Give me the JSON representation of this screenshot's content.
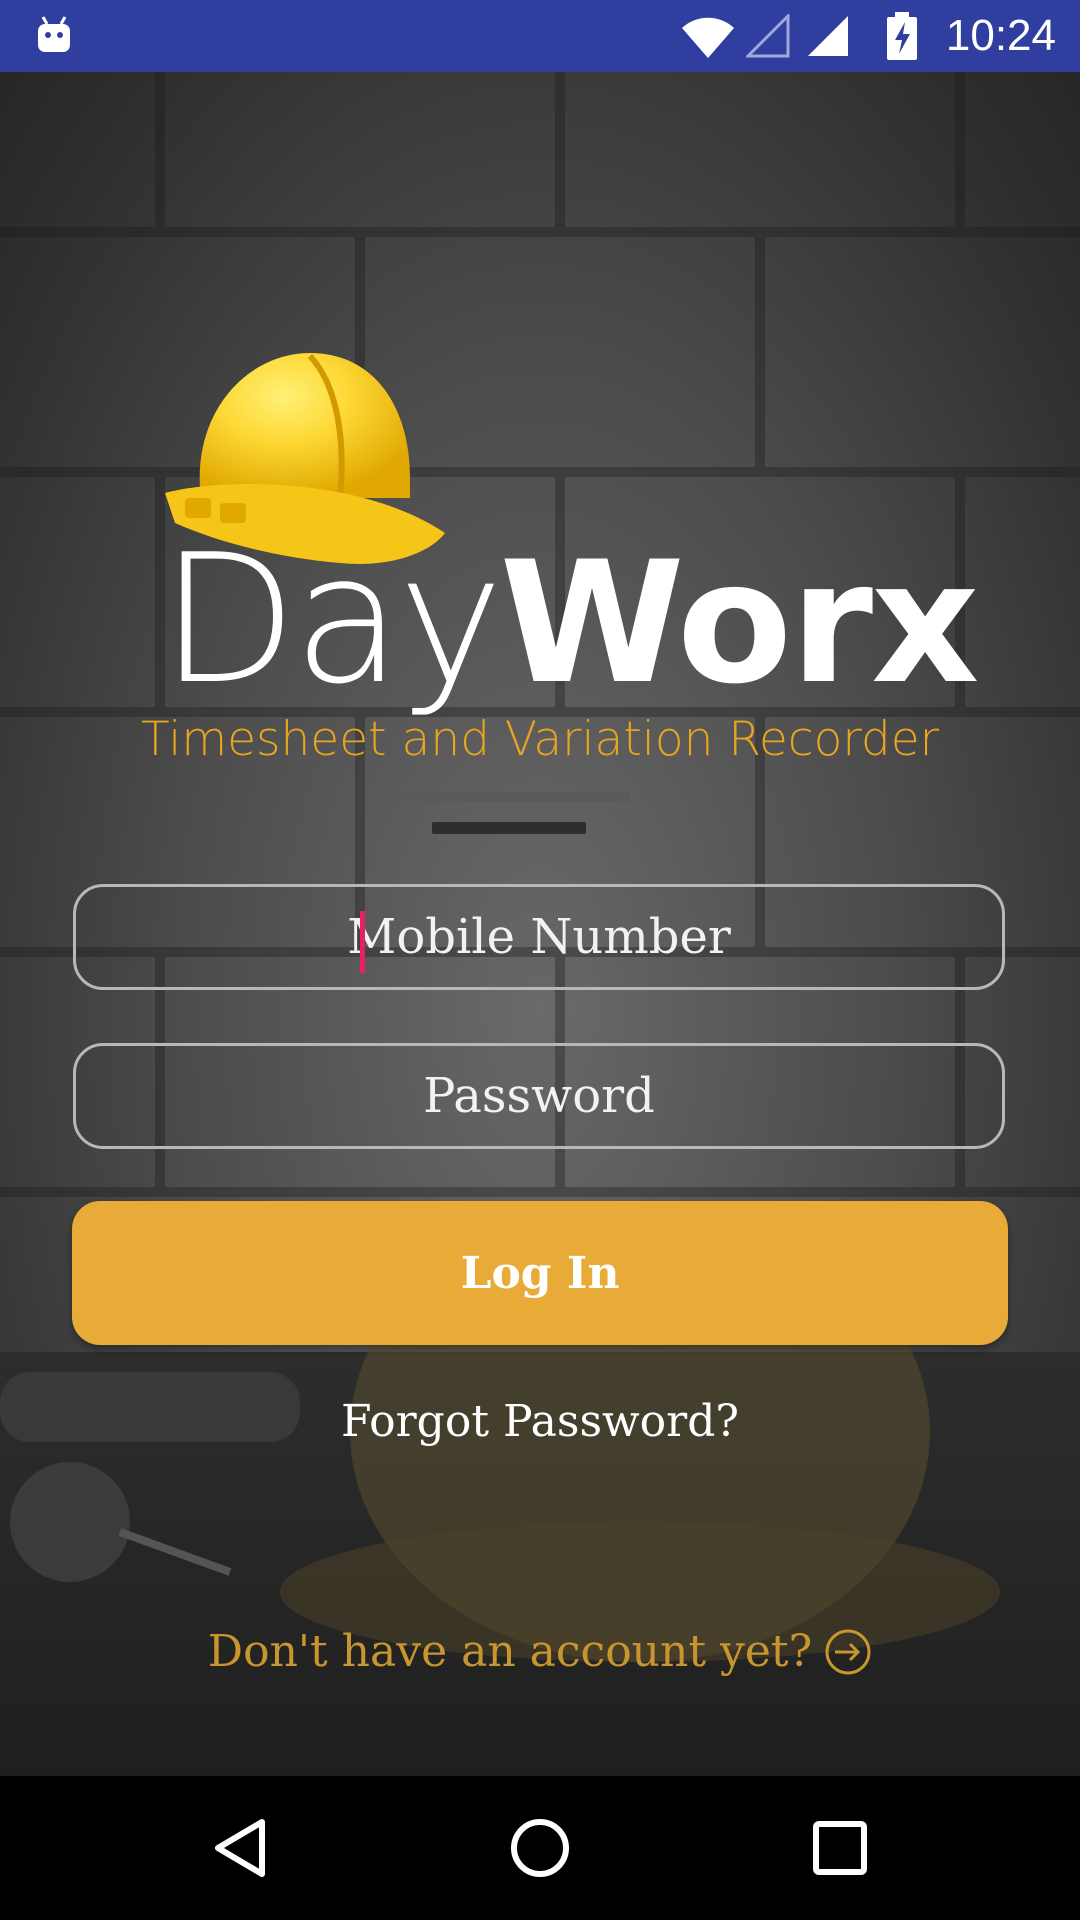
{
  "status_bar": {
    "time": "10:24",
    "icons": [
      "android-icon",
      "wifi-icon",
      "signal-empty-icon",
      "signal-icon",
      "battery-charging-icon"
    ]
  },
  "brand": {
    "name_part1": "Day",
    "name_part2": "Worx",
    "tagline": "Timesheet and Variation Recorder",
    "logo_icon": "hard-hat-icon"
  },
  "form": {
    "mobile_placeholder": "Mobile Number",
    "password_placeholder": "Password",
    "login_label": "Log In",
    "forgot_label": "Forgot Password?",
    "signup_label": "Don't have an account yet?",
    "signup_icon": "arrow-circle-right-icon"
  },
  "colors": {
    "status_bar": "#303f9f",
    "accent": "#e8ab37",
    "tagline": "#e8a520",
    "signup_text": "#c9952e",
    "cursor": "#e91e63"
  },
  "nav_bar": {
    "buttons": [
      "back-icon",
      "home-icon",
      "recent-apps-icon"
    ]
  }
}
